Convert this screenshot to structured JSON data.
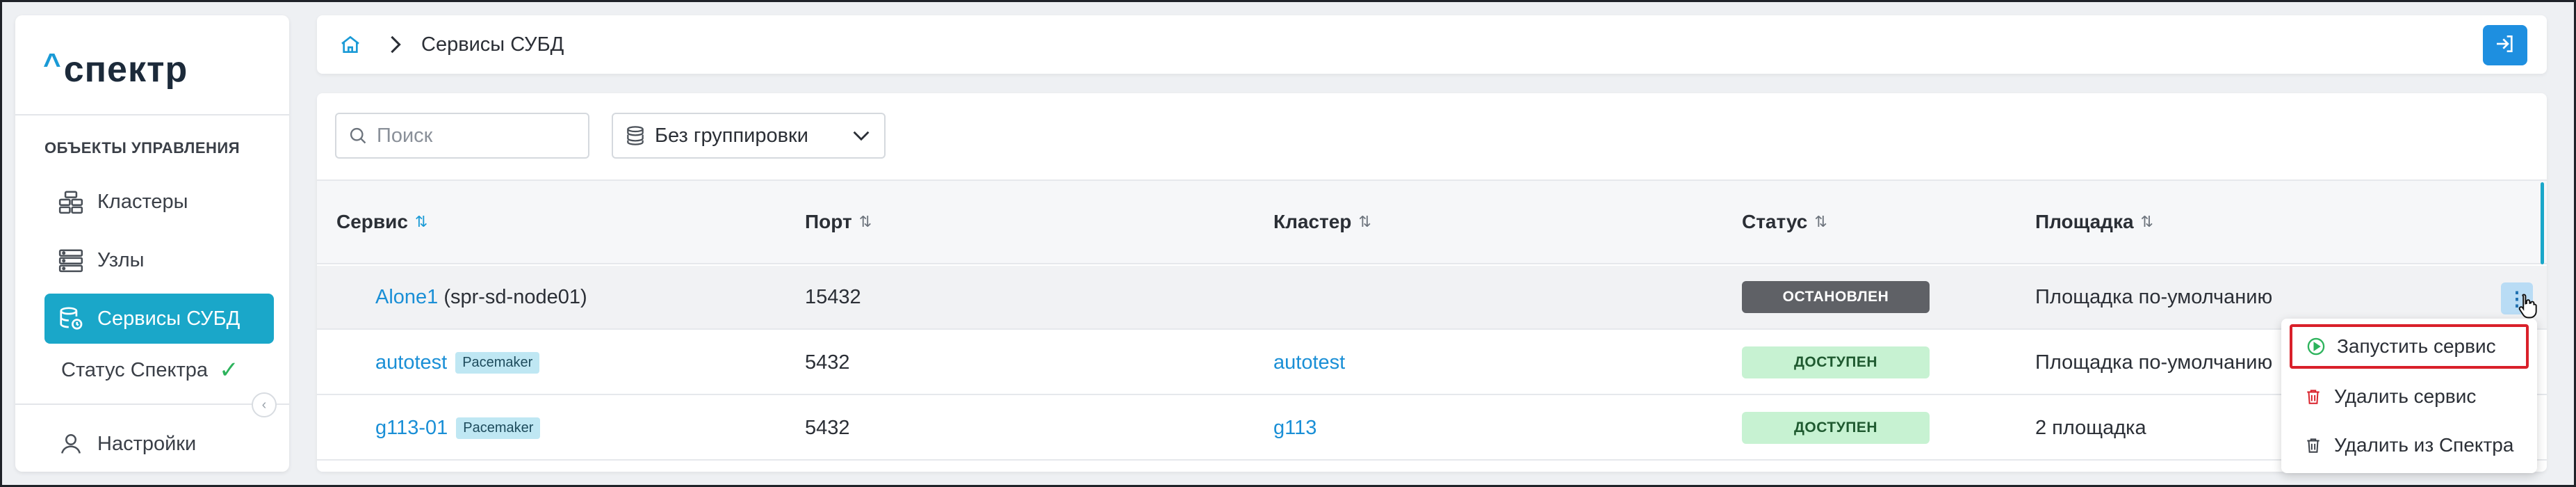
{
  "colors": {
    "accent": "#1aa7c9",
    "link": "#1a8fd6",
    "primary_button": "#1e8fe0",
    "status_stopped_bg": "#5f6166",
    "status_ok_bg": "#c7f2d2",
    "danger": "#d9202a",
    "success": "#2db35c"
  },
  "logo": {
    "caret": "^",
    "word": "спектр"
  },
  "sidebar": {
    "section_title": "ОБЪЕКТЫ УПРАВЛЕНИЯ",
    "items": [
      {
        "label": "Кластеры",
        "icon": "clusters-icon",
        "active": false
      },
      {
        "label": "Узлы",
        "icon": "servers-icon",
        "active": false
      },
      {
        "label": "Сервисы СУБД",
        "icon": "database-service-icon",
        "active": true
      }
    ],
    "status_label": "Статус Спектра",
    "settings_label": "Настройки"
  },
  "header": {
    "breadcrumb": {
      "home_icon": "home-icon",
      "current": "Сервисы СУБД"
    },
    "exit_icon": "login-arrow-icon"
  },
  "toolbar": {
    "search_placeholder": "Поиск",
    "grouping_value": "Без группировки"
  },
  "table": {
    "columns": [
      {
        "label": "Сервис",
        "sort_icon": "⇅"
      },
      {
        "label": "Порт",
        "sort_icon": "⇅"
      },
      {
        "label": "Кластер",
        "sort_icon": "⇅"
      },
      {
        "label": "Статус",
        "sort_icon": "⇅"
      },
      {
        "label": "Площадка",
        "sort_icon": "⇅"
      }
    ],
    "rows": [
      {
        "service": "Alone1",
        "host": "(spr-sd-node01)",
        "tag": "",
        "port": "15432",
        "cluster": "",
        "status": "ОСТАНОВЛЕН",
        "site": "Площадка по-умолчанию"
      },
      {
        "service": "autotest",
        "host": "",
        "tag": "Pacemaker",
        "port": "5432",
        "cluster": "autotest",
        "status": "ДОСТУПЕН",
        "site": "Площадка по-умолчанию"
      },
      {
        "service": "g113-01",
        "host": "",
        "tag": "Pacemaker",
        "port": "5432",
        "cluster": "g113",
        "status": "ДОСТУПЕН",
        "site": "2 площадка"
      }
    ]
  },
  "context_menu": {
    "items": [
      {
        "label": "Запустить сервис",
        "icon": "play-circle-icon"
      },
      {
        "label": "Удалить сервис",
        "icon": "trash-icon"
      },
      {
        "label": "Удалить из Спектра",
        "icon": "trash-icon"
      }
    ]
  }
}
